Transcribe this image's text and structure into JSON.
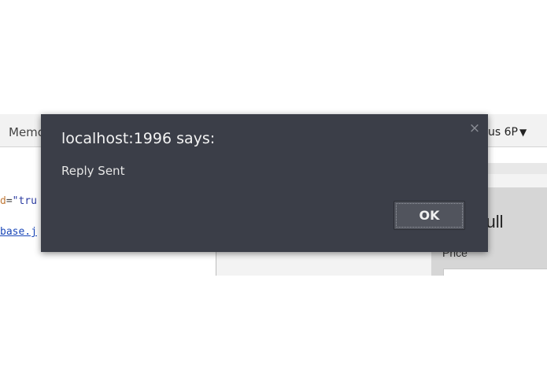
{
  "devtools": {
    "memory_tab_label": "Memo",
    "device_label": "us 6P",
    "caret": "▼"
  },
  "code": {
    "line1_attr": "d",
    "line1_eq": "=",
    "line1_value": "\"tru",
    "line2_link": "base.j"
  },
  "page": {
    "heading": "an Bhull",
    "price_label": "Price"
  },
  "alert": {
    "title": "localhost:1996 says:",
    "message": "Reply Sent",
    "close_glyph": "×",
    "ok_label": "OK"
  }
}
